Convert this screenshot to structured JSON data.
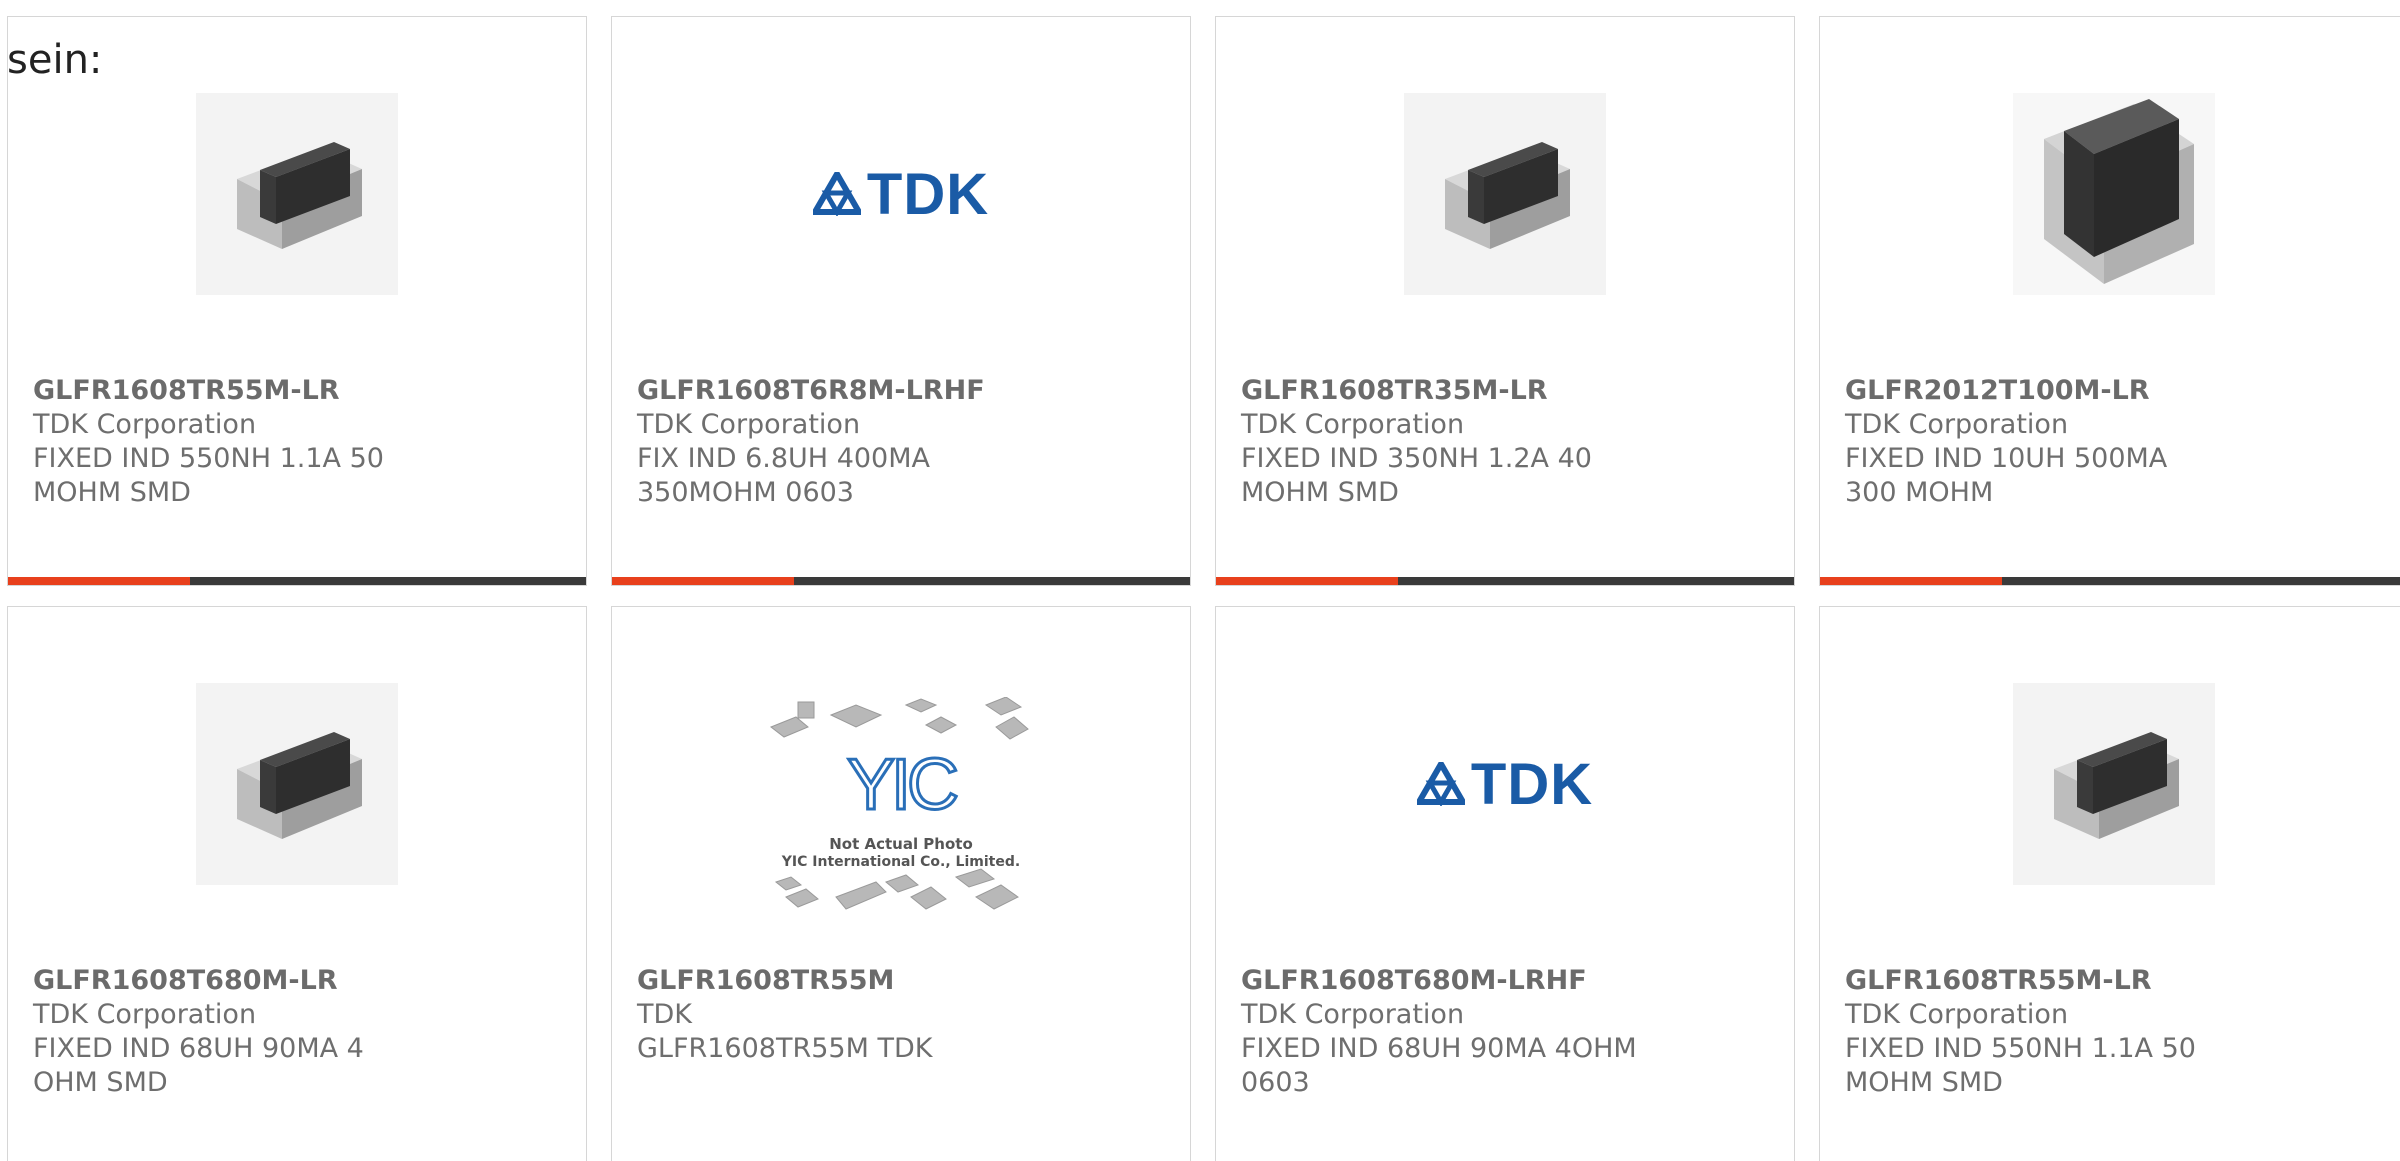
{
  "page": {
    "prefix_text": "sein:"
  },
  "colors": {
    "accent": "#e8401c",
    "bar": "#3a3a3a",
    "tdk_blue": "#1a5ba6",
    "yic_blue": "#2a6fb8"
  },
  "products": [
    {
      "part_number": "GLFR1608TR55M-LR",
      "manufacturer": "TDK Corporation",
      "description": "FIXED IND 550NH 1.1A 50 MOHM SMD",
      "image": "chip-inductor-image"
    },
    {
      "part_number": "GLFR1608T6R8M-LRHF",
      "manufacturer": "TDK Corporation",
      "description": "FIX IND 6.8UH 400MA 350MOHM 0603",
      "image": "tdk-logo-image",
      "logo_text": "TDK"
    },
    {
      "part_number": "GLFR1608TR35M-LR",
      "manufacturer": "TDK Corporation",
      "description": "FIXED IND 350NH 1.2A 40 MOHM SMD",
      "image": "chip-inductor-image"
    },
    {
      "part_number": "GLFR2012T100M-LR",
      "manufacturer": "TDK Corporation",
      "description": "FIXED IND 10UH 500MA 300 MOHM",
      "image": "chip-inductor-large-image"
    },
    {
      "part_number": "GLFR1608T680M-LR",
      "manufacturer": "TDK Corporation",
      "description": "FIXED IND 68UH 90MA 4 OHM SMD",
      "image": "chip-inductor-image"
    },
    {
      "part_number": "GLFR1608TR55M",
      "manufacturer": "TDK",
      "description": "GLFR1608TR55M TDK",
      "image": "not-actual-photo-image",
      "placeholder_logo": "YIC",
      "placeholder_line1": "Not Actual Photo",
      "placeholder_line2": "YIC International Co., Limited."
    },
    {
      "part_number": "GLFR1608T680M-LRHF",
      "manufacturer": "TDK Corporation",
      "description": "FIXED IND 68UH 90MA 4OHM 0603",
      "image": "tdk-logo-image",
      "logo_text": "TDK"
    },
    {
      "part_number": "GLFR1608TR55M-LR",
      "manufacturer": "TDK Corporation",
      "description": "FIXED IND 550NH 1.1A 50 MOHM SMD",
      "image": "chip-inductor-image"
    }
  ]
}
